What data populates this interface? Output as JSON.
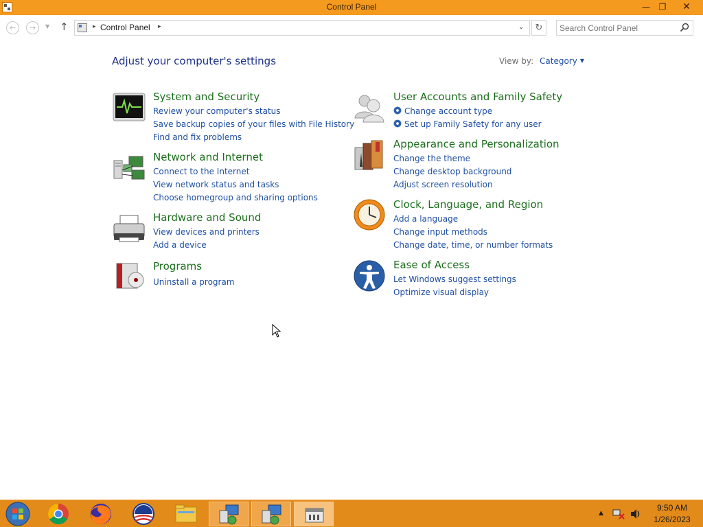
{
  "window": {
    "title": "Control Panel",
    "minimize_glyph": "—",
    "maximize_glyph": "❐",
    "close_glyph": "✕"
  },
  "address": {
    "back_glyph": "←",
    "forward_glyph": "→",
    "recent_glyph": "▼",
    "up_glyph": "↑",
    "separator": "▸",
    "path": "Control Panel",
    "dropdown_glyph": "⌄",
    "refresh_glyph": "↻",
    "search_placeholder": "Search Control Panel"
  },
  "main": {
    "heading": "Adjust your computer's settings",
    "view_by_label": "View by:",
    "view_by_value": "Category",
    "view_by_arrow": "▼"
  },
  "categories": [
    {
      "title": "System and Security",
      "icon": "system-security-icon",
      "links": [
        "Review your computer's status",
        "Save backup copies of your files with File History",
        "Find and fix problems"
      ]
    },
    {
      "title": "Network and Internet",
      "icon": "network-icon",
      "links": [
        "Connect to the Internet",
        "View network status and tasks",
        "Choose homegroup and sharing options"
      ]
    },
    {
      "title": "Hardware and Sound",
      "icon": "printer-icon",
      "links": [
        "View devices and printers",
        "Add a device"
      ]
    },
    {
      "title": "Programs",
      "icon": "programs-icon",
      "links": [
        "Uninstall a program"
      ]
    },
    {
      "title": "User Accounts and Family Safety",
      "icon": "users-icon",
      "links": [
        "Change account type",
        "Set up Family Safety for any user"
      ]
    },
    {
      "title": "Appearance and Personalization",
      "icon": "appearance-icon",
      "links": [
        "Change the theme",
        "Change desktop background",
        "Adjust screen resolution"
      ]
    },
    {
      "title": "Clock, Language, and Region",
      "icon": "clock-icon",
      "links": [
        "Add a language",
        "Change input methods",
        "Change date, time, or number formats"
      ]
    },
    {
      "title": "Ease of Access",
      "icon": "ease-of-access-icon",
      "links": [
        "Let Windows suggest settings",
        "Optimize visual display"
      ]
    }
  ],
  "taskbar": {
    "items": [
      "start-orb-icon",
      "chrome-icon",
      "firefox-icon",
      "obama-logo-icon",
      "file-explorer-icon",
      "network-share-icon",
      "network-share-icon",
      "control-panel-icon"
    ],
    "time": "9:50 AM",
    "date": "1/26/2023",
    "tray_arrow": "▲"
  },
  "colors": {
    "title_bar": "#f39a1f",
    "taskbar": "#e28a1a",
    "heading": "#1e3287",
    "category_title": "#1c6e1c",
    "link": "#1e4fa2"
  }
}
